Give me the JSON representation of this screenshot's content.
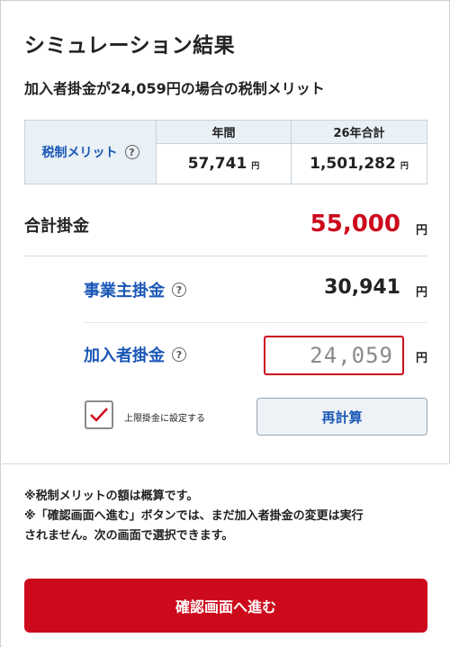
{
  "header": {
    "title": "シミュレーション結果",
    "subtitle": "加入者掛金が24,059円の場合の税制メリット"
  },
  "merit_table": {
    "label": "税制メリット",
    "help_icon": "question-circle-icon",
    "columns": [
      {
        "header": "年間",
        "value": "57,741",
        "unit": "円"
      },
      {
        "header": "26年合計",
        "value": "1,501,282",
        "unit": "円"
      }
    ]
  },
  "total": {
    "label": "合計掛金",
    "value": "55,000",
    "unit": "円",
    "value_color": "#cc0a1c"
  },
  "employer": {
    "label": "事業主掛金",
    "value": "30,941",
    "unit": "円"
  },
  "member": {
    "label": "加入者掛金",
    "input_value": "24,059",
    "unit": "円"
  },
  "cap_checkbox": {
    "label": "上限掛金に設定する",
    "checked": true
  },
  "recalc_button": {
    "label": "再計算"
  },
  "notes": {
    "line1": "※税制メリットの額は概算です。",
    "line2": "※「確認画面へ進む」ボタンでは、まだ加入者掛金の変更は実行",
    "line3": "されません。次の画面で選択できます。"
  },
  "cta_button": {
    "label": "確認画面へ進む"
  },
  "colors": {
    "accent_red": "#cc0a1c",
    "link_blue": "#1a57b6"
  }
}
